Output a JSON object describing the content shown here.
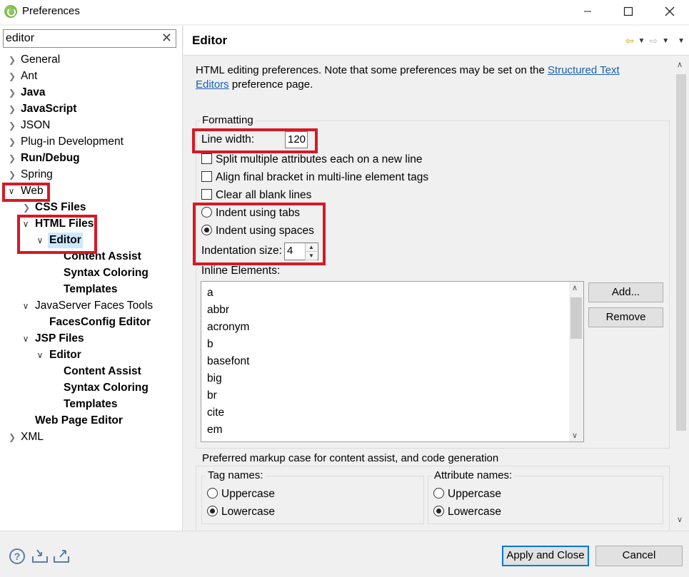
{
  "window": {
    "title": "Preferences",
    "minimize_icon": "minimize-icon",
    "maximize_icon": "maximize-icon",
    "close_icon": "close-icon"
  },
  "filter": {
    "value": "editor",
    "clear_label": "✕"
  },
  "tree": {
    "general": "General",
    "ant": "Ant",
    "java": "Java",
    "javascript": "JavaScript",
    "json": "JSON",
    "plugin": "Plug-in Development",
    "rundebug": "Run/Debug",
    "spring": "Spring",
    "web": "Web",
    "css_files": "CSS Files",
    "html_files": "HTML Files",
    "html_editor": "Editor",
    "html_content_assist": "Content Assist",
    "html_syntax_coloring": "Syntax Coloring",
    "html_templates": "Templates",
    "jsf_tools": "JavaServer Faces Tools",
    "facesconfig": "FacesConfig Editor",
    "jsp_files": "JSP Files",
    "jsp_editor": "Editor",
    "jsp_content_assist": "Content Assist",
    "jsp_syntax_coloring": "Syntax Coloring",
    "jsp_templates": "Templates",
    "web_page_editor": "Web Page Editor",
    "xml": "XML"
  },
  "page": {
    "title": "Editor",
    "desc_before": "HTML editing preferences.  Note that some preferences may be set on the ",
    "desc_link": "Structured Text Editors",
    "desc_after": " preference page."
  },
  "formatting": {
    "group_label": "Formatting",
    "line_width_label": "Line width:",
    "line_width_value": "120",
    "split_attrs": "Split multiple attributes each on a new line",
    "split_attrs_checked": false,
    "align_bracket": "Align final bracket in multi-line element tags",
    "align_bracket_checked": false,
    "clear_blank": "Clear all blank lines",
    "clear_blank_checked": false,
    "indent_tabs": "Indent using tabs",
    "indent_spaces": "Indent using spaces",
    "indent_selected": "spaces",
    "indent_size_label": "Indentation size:",
    "indent_size_value": "4",
    "inline_elements_label": "Inline Elements:",
    "inline_elements": [
      "a",
      "abbr",
      "acronym",
      "b",
      "basefont",
      "big",
      "br",
      "cite",
      "em"
    ],
    "add_button": "Add...",
    "remove_button": "Remove"
  },
  "markup_case": {
    "group_label": "Preferred markup case for content assist, and code generation",
    "tag_names_label": "Tag names:",
    "attr_names_label": "Attribute names:",
    "uppercase": "Uppercase",
    "lowercase": "Lowercase",
    "tag_selected": "lowercase",
    "attr_selected": "lowercase"
  },
  "footer": {
    "apply_close": "Apply and Close",
    "cancel": "Cancel"
  },
  "colors": {
    "highlight_box": "#d41a25",
    "selection": "#cce8ff",
    "link": "#1a5fb4",
    "primary_border": "#0078d7"
  }
}
